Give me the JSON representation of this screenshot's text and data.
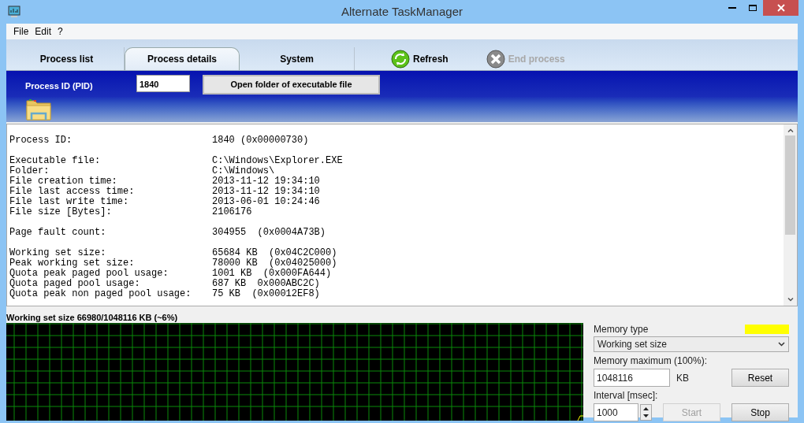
{
  "window": {
    "title": "Alternate TaskManager"
  },
  "menu": [
    {
      "label": "File"
    },
    {
      "label": "Edit"
    },
    {
      "label": "?"
    }
  ],
  "tabs": [
    {
      "label": "Process list",
      "selected": false
    },
    {
      "label": "Process details",
      "selected": true
    },
    {
      "label": "System",
      "selected": false
    }
  ],
  "toolbar": [
    {
      "label": "Refresh",
      "kind": "refresh",
      "disabled": false
    },
    {
      "label": "End process",
      "kind": "end",
      "disabled": true
    }
  ],
  "header": {
    "pid_label": "Process ID (PID)",
    "pid_value": "1840",
    "open_folder_button": "Open folder of executable file"
  },
  "details": [
    [
      {
        "label": "Process ID:",
        "value": "1840 (0x00000730)"
      }
    ],
    [
      {
        "label": "Executable file:",
        "value": "C:\\Windows\\Explorer.EXE"
      },
      {
        "label": "Folder:",
        "value": "C:\\Windows\\"
      },
      {
        "label": "File creation time:",
        "value": "2013-11-12 19:34:10"
      },
      {
        "label": "File last access time:",
        "value": "2013-11-12 19:34:10"
      },
      {
        "label": "File last write time:",
        "value": "2013-06-01 10:24:46"
      },
      {
        "label": "File size [Bytes]:",
        "value": "2106176"
      }
    ],
    [
      {
        "label": "Page fault count:",
        "value": "304955  (0x0004A73B)"
      }
    ],
    [
      {
        "label": "Working set size:",
        "value": "65684 KB  (0x04C2C000)"
      },
      {
        "label": "Peak working set size:",
        "value": "78000 KB  (0x04025000)"
      },
      {
        "label": "Quota peak paged pool usage:",
        "value": "1001 KB  (0x000FA644)"
      },
      {
        "label": "Quota paged pool usage:",
        "value": "687 KB  0x000ABC2C)"
      },
      {
        "label": "Quota peak non paged pool usage:",
        "value": "75 KB  (0x00012EF8)"
      }
    ]
  ],
  "graph": {
    "caption": "Working set size 66980/1048116 KB (~6%)"
  },
  "controls": {
    "memory_type_label": "Memory type",
    "memory_type_swatch": {
      "color": "#ffff00"
    },
    "memory_type_value": "Working set size",
    "memory_max_label": "Memory maximum (100%):",
    "memory_max_value": "1048116",
    "memory_max_unit": "KB",
    "reset_button": "Reset",
    "interval_label": "Interval [msec]:",
    "interval_value": "1000",
    "start_button": {
      "label": "Start",
      "disabled": true
    },
    "stop_button": {
      "label": "Stop",
      "disabled": false
    }
  }
}
